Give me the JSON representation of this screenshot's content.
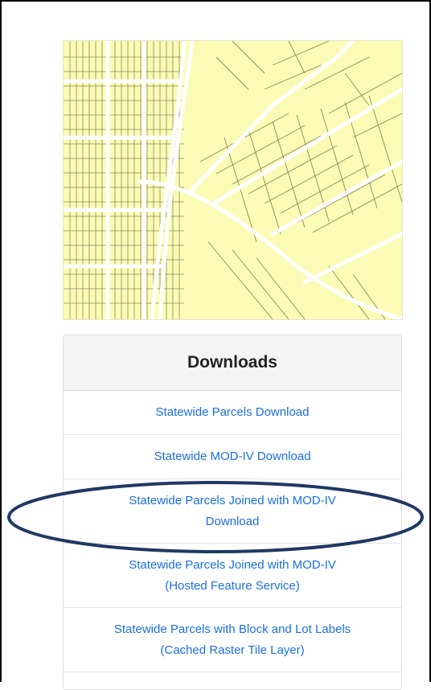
{
  "panel": {
    "heading": "Downloads",
    "items": [
      {
        "line1": "Statewide Parcels Download",
        "line2": ""
      },
      {
        "line1": "Statewide MOD-IV Download",
        "line2": ""
      },
      {
        "line1": "Statewide Parcels Joined with MOD-IV",
        "line2": "Download"
      },
      {
        "line1": "Statewide Parcels Joined with MOD-IV",
        "line2": "(Hosted Feature Service)"
      },
      {
        "line1": "Statewide Parcels with Block and Lot Labels",
        "line2": "(Cached Raster Tile Layer)"
      }
    ]
  },
  "colors": {
    "map_fill": "#fbfbb6",
    "parcel_line": "#8a8a5a",
    "road": "#ffffff",
    "link": "#1a6fe0",
    "highlight_ellipse": "#1f3864"
  },
  "icons": {
    "map": "parcel-map-thumbnail"
  }
}
